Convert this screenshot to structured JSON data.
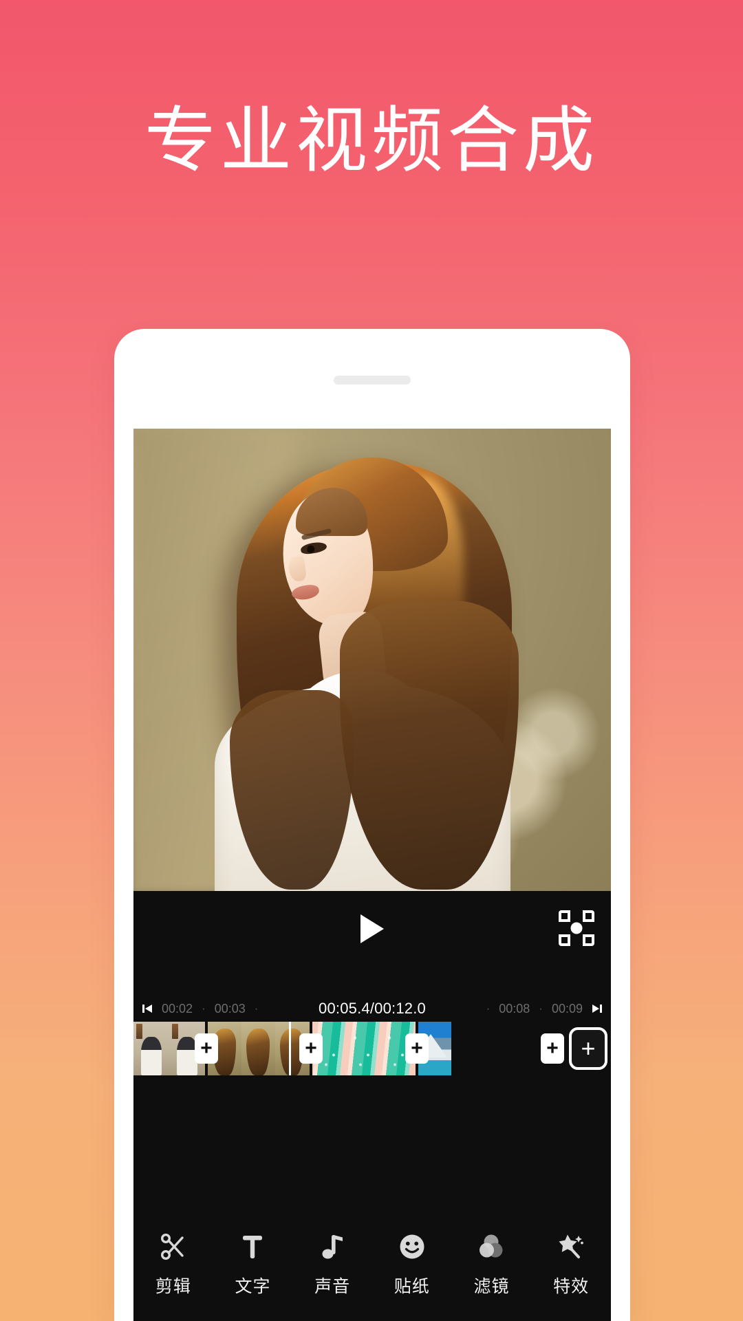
{
  "page": {
    "headline": "专业视频合成",
    "background": {
      "top_color": "#F2576B",
      "bottom_color": "#F5B271"
    }
  },
  "phone": {
    "speaker_name": "earpiece-speaker"
  },
  "app": {
    "preview": {
      "play_label": "播放",
      "fullscreen_label": "全屏"
    },
    "ruler": {
      "prev_icon": "skip-previous-icon",
      "next_icon": "skip-next-icon",
      "left_ticks": [
        "00:02",
        "00:03"
      ],
      "right_ticks": [
        "00:08",
        "00:09"
      ],
      "current_time": "00:05.4/00:12.0",
      "dot": "·"
    },
    "timeline": {
      "plus_label": "+",
      "add_clip_label": "+",
      "clips": [
        {
          "name": "clip-girl-indoor"
        },
        {
          "name": "clip-golden-portrait"
        },
        {
          "name": "clip-teal-pattern"
        },
        {
          "name": "clip-mountain-lake"
        }
      ]
    },
    "toolbar": {
      "items": [
        {
          "label": "剪辑",
          "icon": "scissors-icon"
        },
        {
          "label": "文字",
          "icon": "text-t-icon"
        },
        {
          "label": "声音",
          "icon": "music-note-icon"
        },
        {
          "label": "贴纸",
          "icon": "smiley-sticker-icon"
        },
        {
          "label": "滤镜",
          "icon": "filter-circles-icon"
        },
        {
          "label": "特效",
          "icon": "magic-wand-icon"
        }
      ]
    }
  }
}
